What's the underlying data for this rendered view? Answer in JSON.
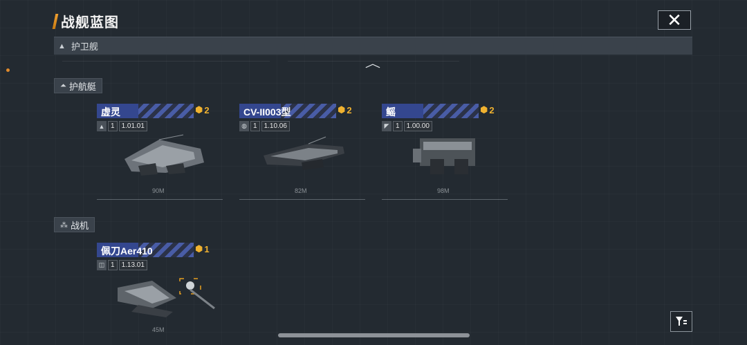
{
  "header": {
    "title": "战舰蓝图"
  },
  "tabs": {
    "current": "护卫舰"
  },
  "sections": [
    {
      "label": "护航艇"
    },
    {
      "label": "战机"
    }
  ],
  "cards": [
    {
      "name": "虚灵",
      "rank": "2",
      "level": "1",
      "version": "1.01.01",
      "scale": "90M"
    },
    {
      "name": "CV-II003型",
      "rank": "2",
      "level": "1",
      "version": "1.10.06",
      "scale": "82M"
    },
    {
      "name": "鳐",
      "rank": "2",
      "level": "1",
      "version": "1.00.00",
      "scale": "98M"
    },
    {
      "name": "佩刀Aer410",
      "rank": "1",
      "level": "1",
      "version": "1.13.01",
      "scale": "45M"
    }
  ],
  "colors": {
    "accent": "#f0a030",
    "card_header": "#34478f",
    "rank": "#f0b230"
  },
  "icons": [
    "close-icon",
    "chevron-up-icon",
    "filter-icon",
    "rank-badge-icon",
    "ship-type-icon"
  ]
}
